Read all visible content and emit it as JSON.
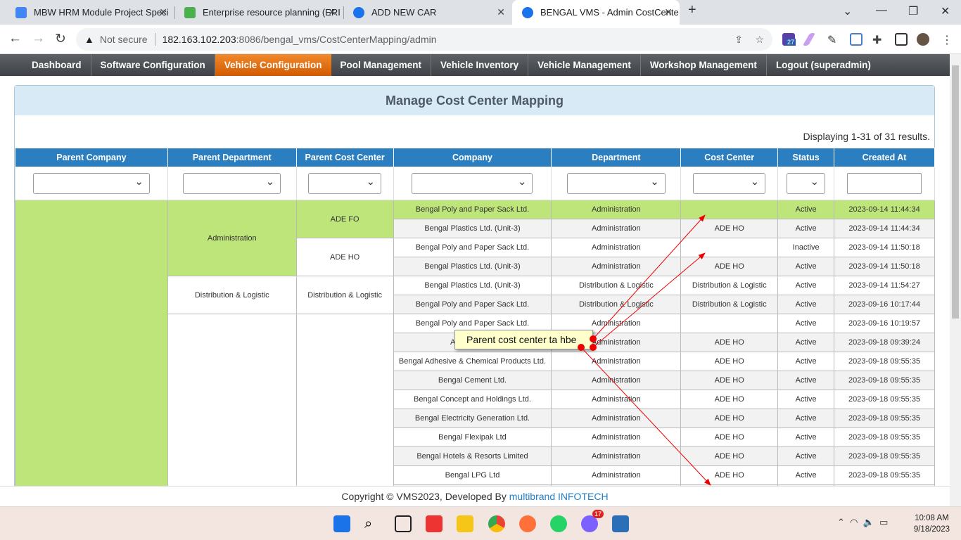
{
  "browser": {
    "tabs": [
      {
        "title": "MBW HRM Module Project Speci",
        "color": "#4285f4"
      },
      {
        "title": "Enterprise resource planning (ERI",
        "color": "#4caf50"
      },
      {
        "title": "ADD NEW CAR",
        "color": "#1a73e8"
      },
      {
        "title": "BENGAL VMS - Admin CostCente",
        "color": "#1a73e8"
      }
    ],
    "not_secure": "Not secure",
    "url_host": "182.163.102.203",
    "url_rest": ":8086/bengal_vms/CostCenterMapping/admin",
    "ext_badge": "27"
  },
  "menu": [
    "Dashboard",
    "Software Configuration",
    "Vehicle Configuration",
    "Pool Management",
    "Vehicle Inventory",
    "Vehicle Management",
    "Workshop Management",
    "Logout (superadmin)"
  ],
  "page": {
    "title": "Manage Cost Center Mapping",
    "summary": "Displaying 1-31 of 31 results."
  },
  "columns": [
    "Parent Company",
    "Parent Department",
    "Parent Cost Center",
    "Company",
    "Department",
    "Cost Center",
    "Status",
    "Created At"
  ],
  "groups": {
    "dept_admin": "Administration",
    "dept_dist": "Distribution & Logistic",
    "pcc_fo": "ADE FO",
    "pcc_ho": "ADE HO",
    "pcc_dist": "Distribution & Logistic"
  },
  "rows": [
    [
      "Bengal Poly and Paper Sack Ltd.",
      "Administration",
      "",
      "Active",
      "2023-09-14 11:44:34"
    ],
    [
      "Bengal Plastics Ltd. (Unit-3)",
      "Administration",
      "ADE HO",
      "Active",
      "2023-09-14 11:44:34"
    ],
    [
      "Bengal Poly and Paper Sack Ltd.",
      "Administration",
      "",
      "Inactive",
      "2023-09-14 11:50:18"
    ],
    [
      "Bengal Plastics Ltd. (Unit-3)",
      "Administration",
      "ADE HO",
      "Active",
      "2023-09-14 11:50:18"
    ],
    [
      "Bengal Plastics Ltd. (Unit-3)",
      "Distribution & Logistic",
      "Distribution & Logistic",
      "Active",
      "2023-09-14 11:54:27"
    ],
    [
      "Bengal Poly and Paper Sack Ltd.",
      "Distribution & Logistic",
      "Distribution & Logistic",
      "Active",
      "2023-09-16 10:17:44"
    ],
    [
      "Bengal Poly and Paper Sack Ltd.",
      "Administration",
      "",
      "Active",
      "2023-09-16 10:19:57"
    ],
    [
      "AJ Overseas",
      "Administration",
      "ADE HO",
      "Active",
      "2023-09-18 09:39:24"
    ],
    [
      "Bengal Adhesive & Chemical Products Ltd.",
      "Administration",
      "ADE HO",
      "Active",
      "2023-09-18 09:55:35"
    ],
    [
      "Bengal Cement Ltd.",
      "Administration",
      "ADE HO",
      "Active",
      "2023-09-18 09:55:35"
    ],
    [
      "Bengal Concept and Holdings Ltd.",
      "Administration",
      "ADE HO",
      "Active",
      "2023-09-18 09:55:35"
    ],
    [
      "Bengal Electricity Generation Ltd.",
      "Administration",
      "ADE HO",
      "Active",
      "2023-09-18 09:55:35"
    ],
    [
      "Bengal Flexipak Ltd",
      "Administration",
      "ADE HO",
      "Active",
      "2023-09-18 09:55:35"
    ],
    [
      "Bengal Hotels & Resorts Limited",
      "Administration",
      "ADE HO",
      "Active",
      "2023-09-18 09:55:35"
    ],
    [
      "Bengal LPG Ltd",
      "Administration",
      "ADE HO",
      "Active",
      "2023-09-18 09:55:35"
    ],
    [
      "",
      "",
      "",
      "",
      ""
    ]
  ],
  "annotation": "Parent cost center ta hbe",
  "footer": {
    "text": "Copyright © VMS2023, Developed By ",
    "link": "multibrand INFOTECH"
  },
  "taskbar": {
    "badge": "17",
    "time": "10:08 AM",
    "date": "9/18/2023"
  },
  "colors": {
    "accent": "#2b7fc0",
    "highlight": "#bde57a",
    "active_menu": "#e8741a"
  }
}
